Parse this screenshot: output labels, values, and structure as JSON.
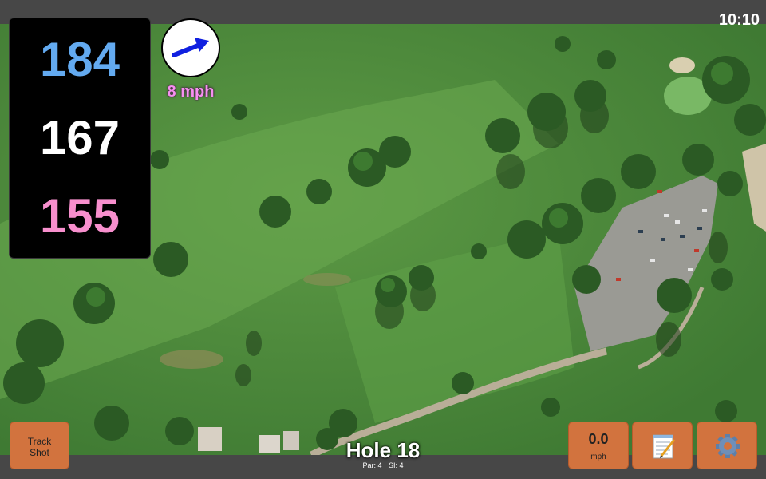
{
  "status_bar": {
    "time": "10:10"
  },
  "distances": {
    "back": "184",
    "middle": "167",
    "front": "155"
  },
  "wind": {
    "speed_label": "8 mph",
    "direction_icon": "wind-arrow-icon",
    "arrow_color": "#1020e0"
  },
  "buttons": {
    "track_shot": {
      "line1": "Track",
      "line2": "Shot"
    },
    "speed": {
      "value": "0.0",
      "unit": "mph"
    },
    "notes_icon": "notepad-icon",
    "settings_icon": "gear-icon"
  },
  "hole": {
    "title": "Hole 18",
    "par": "Par: 4",
    "stroke_index": "SI: 4"
  },
  "colors": {
    "button_bg": "#d2733e",
    "back_distance": "#63aaf0",
    "middle_distance": "#ffffff",
    "front_distance": "#f78fcd",
    "wind_text": "#f78ff0",
    "bar_bg": "#474747"
  }
}
